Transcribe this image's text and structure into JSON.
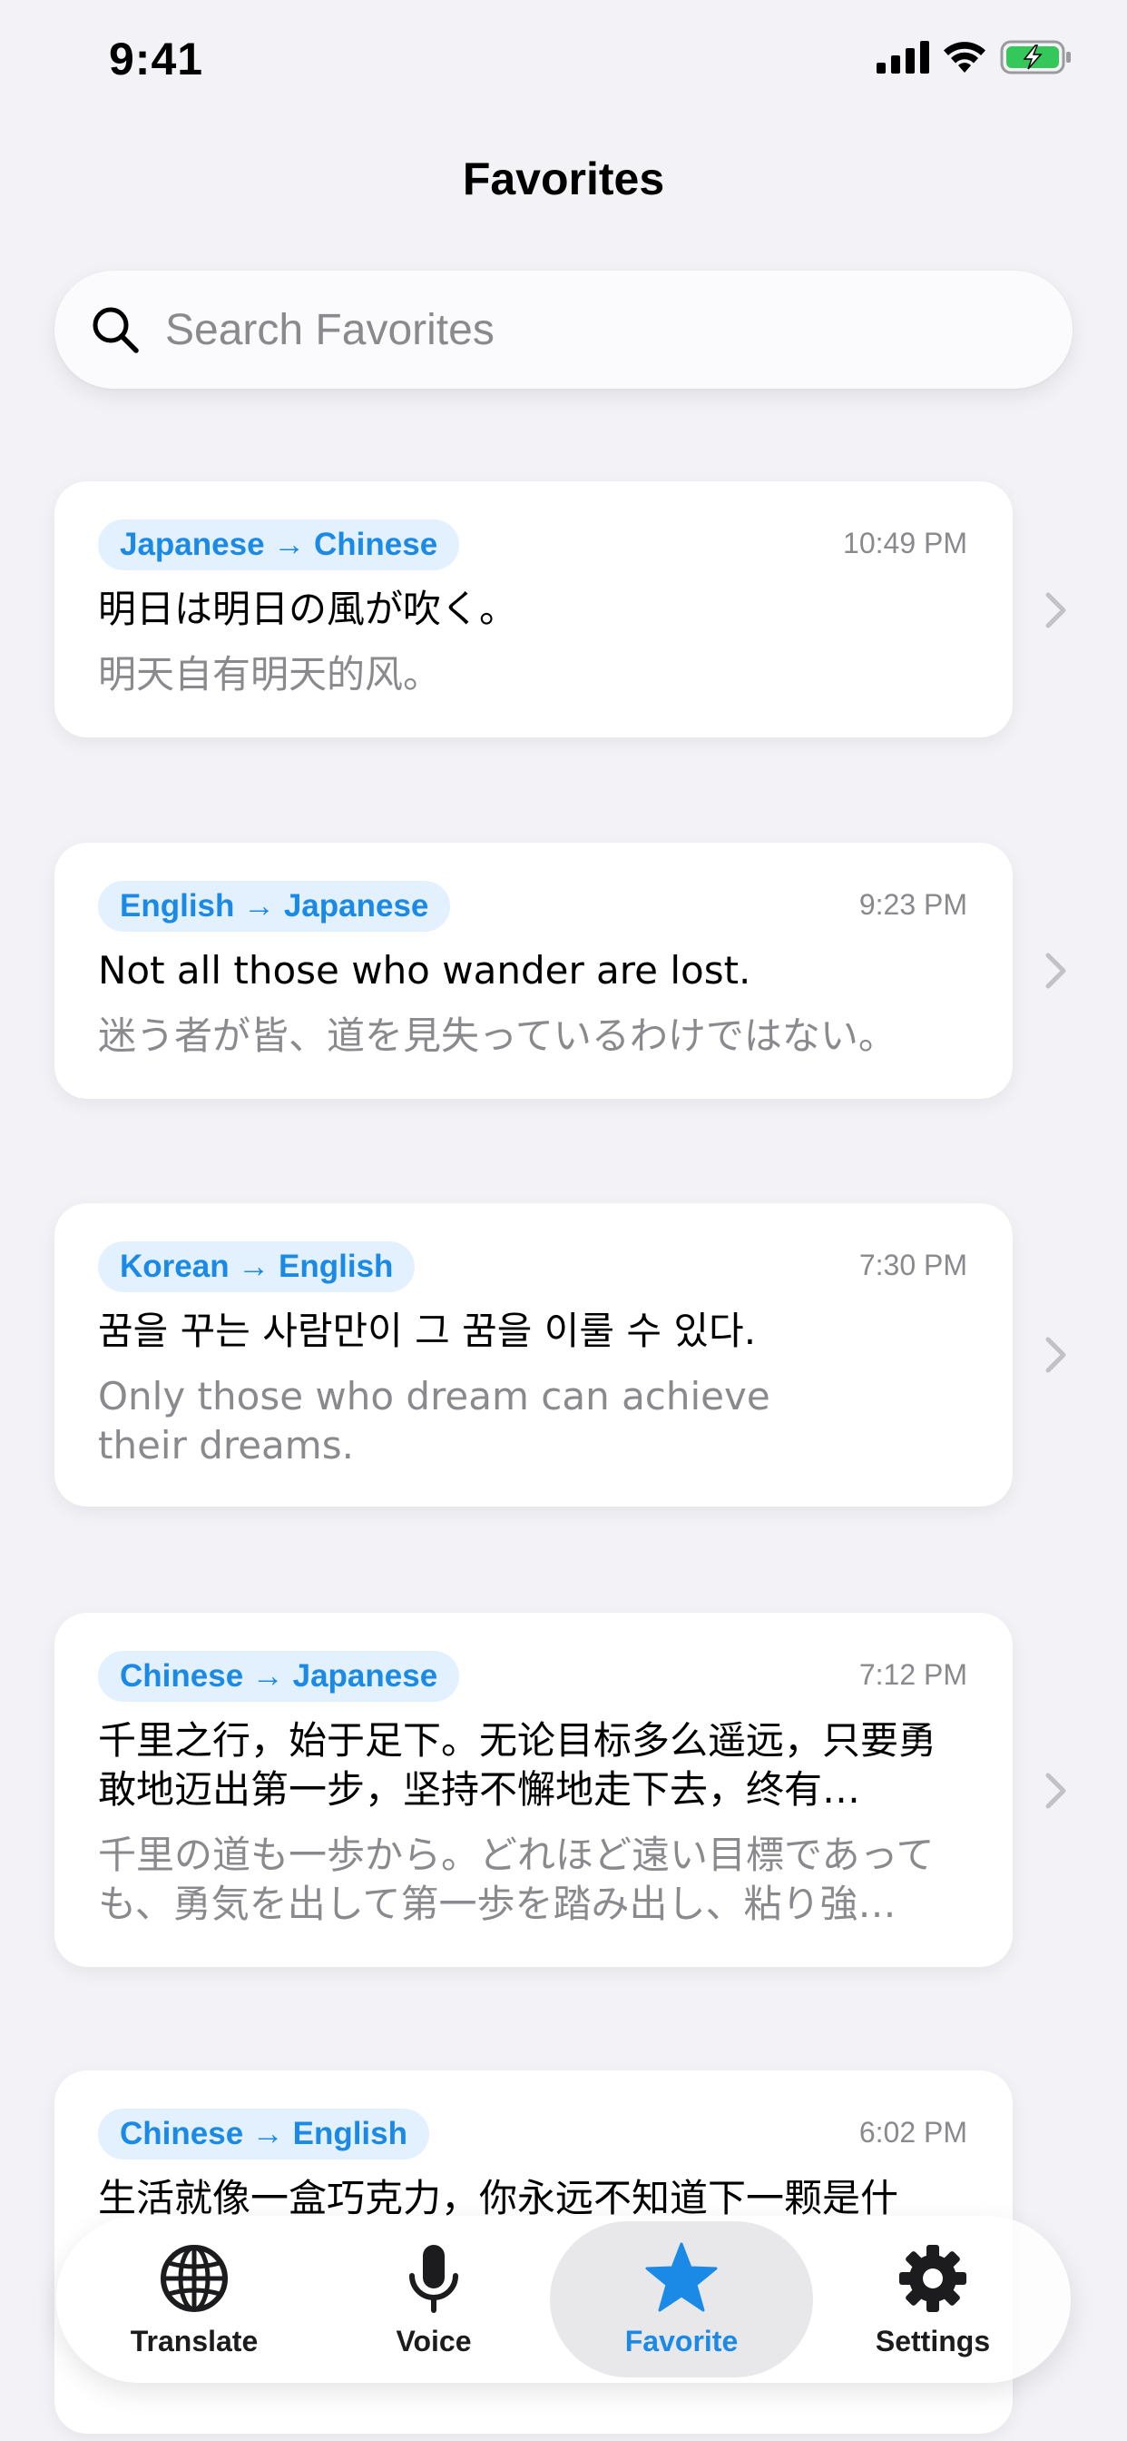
{
  "status_bar": {
    "time": "9:41"
  },
  "nav": {
    "title": "Favorites"
  },
  "search": {
    "placeholder": "Search Favorites",
    "value": ""
  },
  "favorites": [
    {
      "langs": "Japanese → Chinese",
      "time": "10:49 PM",
      "source": "明日は明日の風が吹く。",
      "translation": "明天自有明天的风。"
    },
    {
      "langs": "English → Japanese",
      "time": "9:23 PM",
      "source": "Not all those who wander are lost.",
      "translation": "迷う者が皆、道を見失っているわけではない。"
    },
    {
      "langs": "Korean → English",
      "time": "7:30 PM",
      "source": "꿈을 꾸는 사람만이 그 꿈을 이룰 수 있다.",
      "translation": "Only those who dream can achieve their dreams."
    },
    {
      "langs": "Chinese → Japanese",
      "time": "7:12 PM",
      "source": "千里之行，始于足下。无论目标多么遥远，只要勇敢地迈出第一步，坚持不懈地走下去，终有…",
      "translation": "千里の道も一歩から。どれほど遠い目標であっても、勇気を出して第一歩を踏み出し、粘り強…"
    },
    {
      "langs": "Chinese → English",
      "time": "6:02 PM",
      "source": "生活就像一盒巧克力，你永远不知道下一颗是什",
      "translation": ""
    }
  ],
  "tabs": [
    {
      "label": "Translate",
      "icon": "globe-icon",
      "active": false
    },
    {
      "label": "Voice",
      "icon": "microphone-icon",
      "active": false
    },
    {
      "label": "Favorite",
      "icon": "star-icon",
      "active": true
    },
    {
      "label": "Settings",
      "icon": "gear-icon",
      "active": false
    }
  ],
  "colors": {
    "accent": "#1a8ae6",
    "pill_bg": "#e3f0fd",
    "background": "#f2f2f7",
    "secondary_text": "#8a8a8e",
    "battery_green": "#34c759"
  }
}
